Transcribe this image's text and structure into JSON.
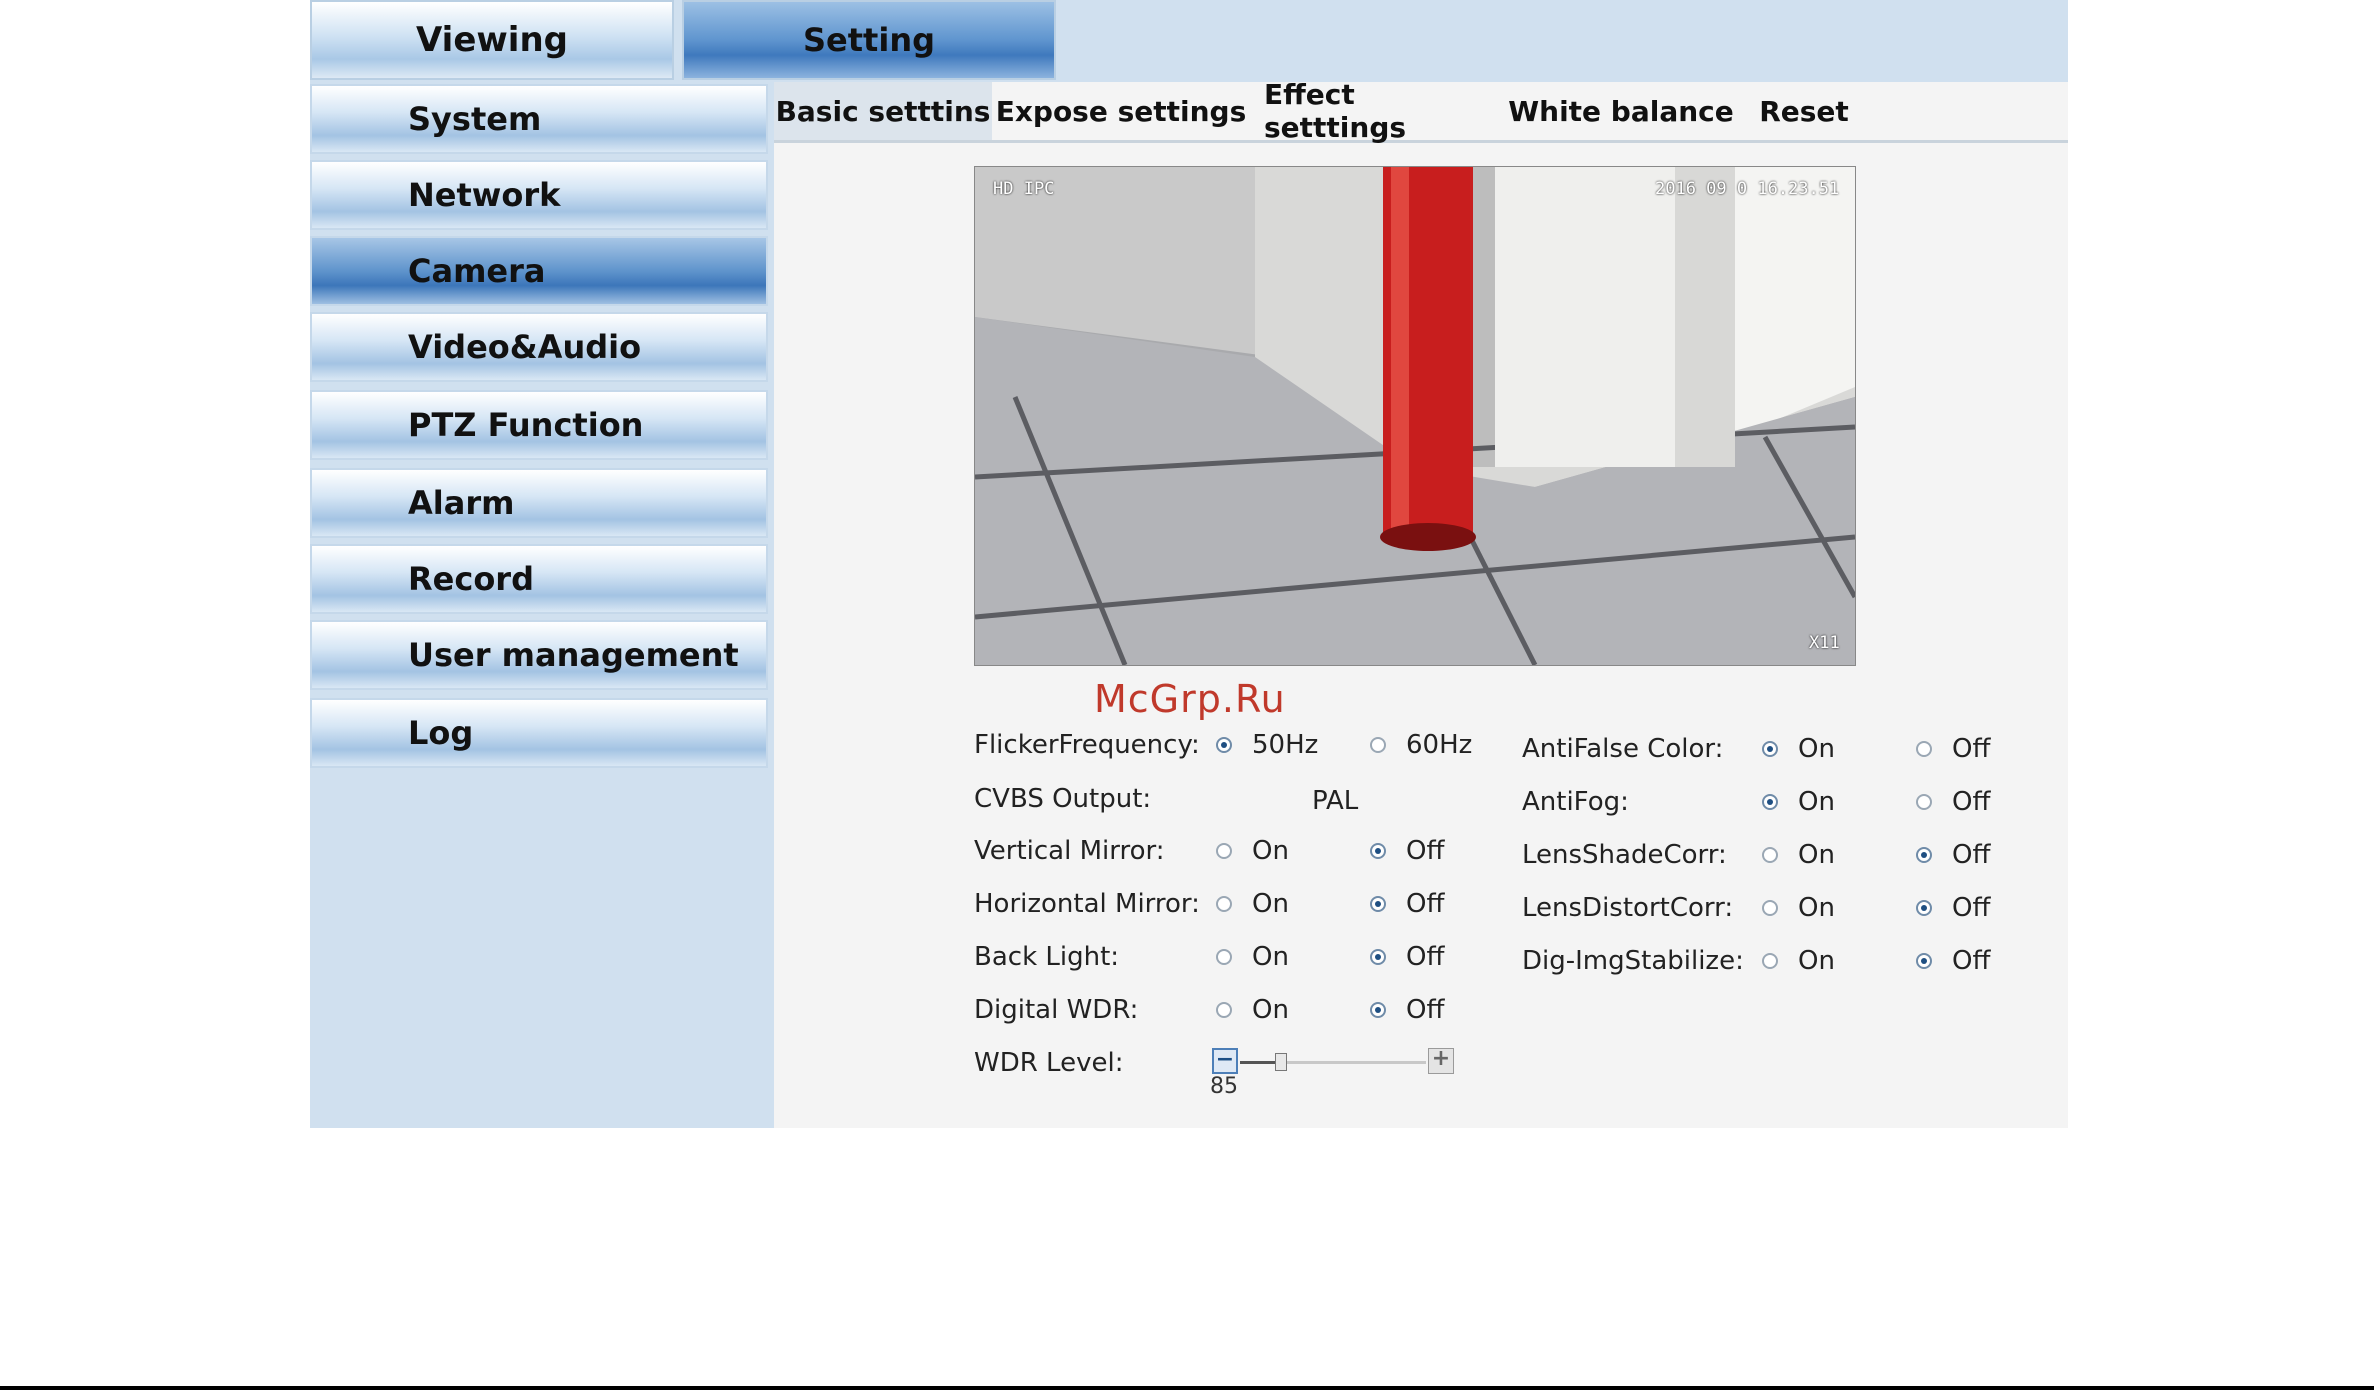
{
  "top_tabs": [
    {
      "label": "Viewing",
      "active": false
    },
    {
      "label": "Setting",
      "active": true
    }
  ],
  "sidebar": {
    "items": [
      {
        "label": "System"
      },
      {
        "label": "Network"
      },
      {
        "label": "Camera",
        "active": true
      },
      {
        "label": "Video&Audio"
      },
      {
        "label": "PTZ Function"
      },
      {
        "label": "Alarm"
      },
      {
        "label": "Record"
      },
      {
        "label": "User management"
      },
      {
        "label": "Log"
      }
    ]
  },
  "sub_tabs": [
    {
      "label": "Basic setttins",
      "active": true
    },
    {
      "label": "Expose settings"
    },
    {
      "label": "Effect setttings"
    },
    {
      "label": "White balance"
    },
    {
      "label": "Reset"
    }
  ],
  "preview": {
    "osd_name": "HD IPC",
    "osd_timestamp": "2016 09 0  16.23.51",
    "osd_zoom": "X11"
  },
  "watermark": "McGrp.Ru",
  "settings_left": {
    "flicker": {
      "label": "FlickerFrequency:",
      "opt1": "50Hz",
      "opt2": "60Hz",
      "selected": "50Hz"
    },
    "cvbs": {
      "label": "CVBS Output:",
      "value": "PAL"
    },
    "vmirror": {
      "label": "Vertical Mirror:",
      "on": "On",
      "off": "Off",
      "selected": "Off"
    },
    "hmirror": {
      "label": "Horizontal Mirror:",
      "on": "On",
      "off": "Off",
      "selected": "Off"
    },
    "backlight": {
      "label": "Back Light:",
      "on": "On",
      "off": "Off",
      "selected": "Off"
    },
    "dwdr": {
      "label": "Digital WDR:",
      "on": "On",
      "off": "Off",
      "selected": "Off"
    },
    "wdr_level": {
      "label": "WDR Level:",
      "value": "85",
      "minus": "−",
      "plus": "+",
      "fraction": 0.22
    }
  },
  "settings_right": {
    "antifalse": {
      "label": "AntiFalse Color:",
      "on": "On",
      "off": "Off",
      "selected": "On"
    },
    "antifog": {
      "label": "AntiFog:",
      "on": "On",
      "off": "Off",
      "selected": "On"
    },
    "lensshade": {
      "label": "LensShadeCorr:",
      "on": "On",
      "off": "Off",
      "selected": "Off"
    },
    "lensdistort": {
      "label": "LensDistortCorr:",
      "on": "On",
      "off": "Off",
      "selected": "Off"
    },
    "stabilize": {
      "label": "Dig-ImgStabilize:",
      "on": "On",
      "off": "Off",
      "selected": "Off"
    }
  },
  "colors": {
    "accent": "#3f79bd",
    "panel": "#d0e0ef",
    "radio_selected": "#1f4f82",
    "post_red": "#c81e1e"
  }
}
